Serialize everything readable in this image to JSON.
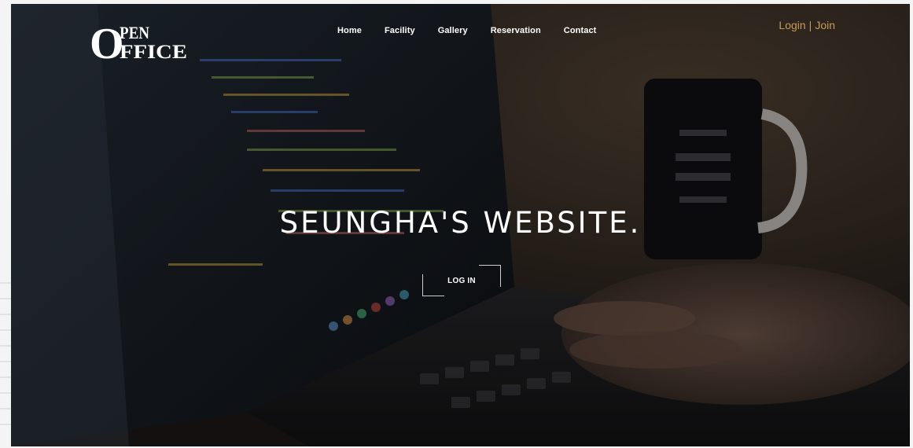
{
  "brand": {
    "logo_text_top": "PEN",
    "logo_text_bottom": "FFICE",
    "logo_letter": "O"
  },
  "nav": {
    "items": [
      {
        "label": "Home"
      },
      {
        "label": "Facility"
      },
      {
        "label": "Gallery"
      },
      {
        "label": "Reservation"
      },
      {
        "label": "Contact"
      }
    ]
  },
  "auth": {
    "login_label": "Login",
    "separator": "|",
    "join_label": "Join"
  },
  "hero": {
    "title": "SEUNGHA'S WEBSITE.",
    "button_label": "LOG IN"
  },
  "colors": {
    "accent": "#c89a56",
    "text": "#ffffff",
    "overlay": "#1d1a18"
  }
}
